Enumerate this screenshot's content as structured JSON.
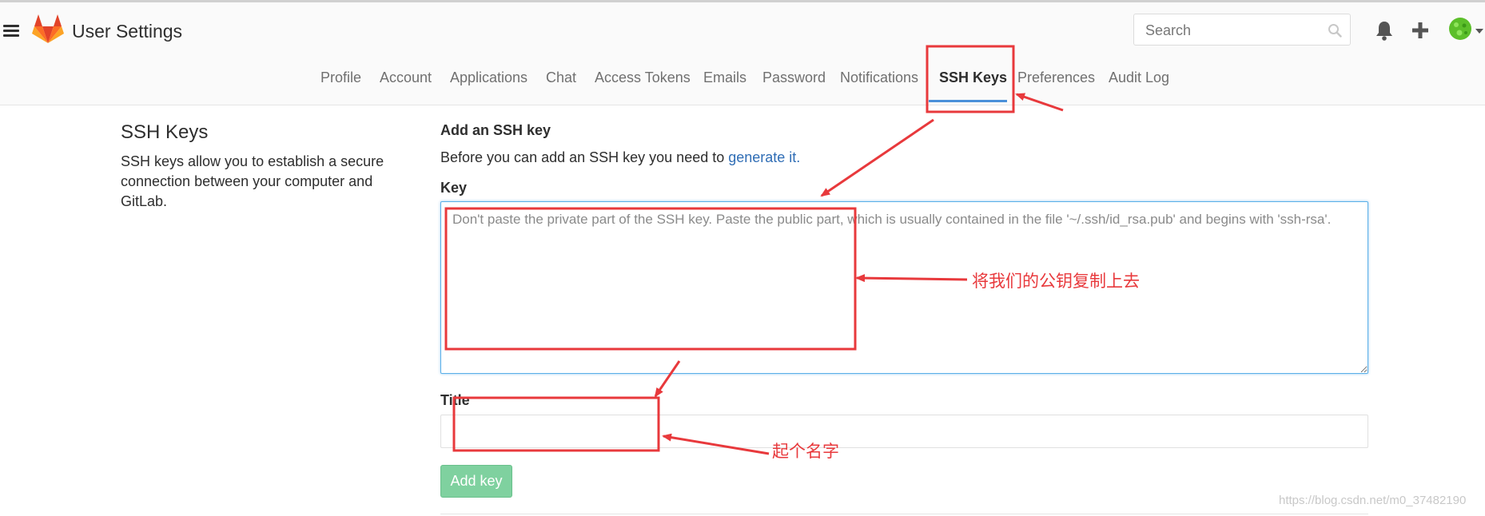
{
  "header": {
    "title": "User Settings",
    "search_placeholder": "Search"
  },
  "nav": {
    "tabs": [
      {
        "label": "Profile"
      },
      {
        "label": "Account"
      },
      {
        "label": "Applications"
      },
      {
        "label": "Chat"
      },
      {
        "label": "Access Tokens"
      },
      {
        "label": "Emails"
      },
      {
        "label": "Password"
      },
      {
        "label": "Notifications"
      },
      {
        "label": "SSH Keys",
        "active": true
      },
      {
        "label": "Preferences"
      },
      {
        "label": "Audit Log"
      }
    ]
  },
  "sidebar": {
    "title": "SSH Keys",
    "description": "SSH keys allow you to establish a secure connection between your computer and GitLab."
  },
  "form": {
    "heading": "Add an SSH key",
    "hint_prefix": "Before you can add an SSH key you need to ",
    "hint_link": "generate it.",
    "key_label": "Key",
    "key_placeholder": "Don't paste the private part of the SSH key. Paste the public part, which is usually contained in the file '~/.ssh/id_rsa.pub' and begins with 'ssh-rsa'.",
    "key_value": "",
    "title_label": "Title",
    "title_value": "",
    "submit_label": "Add key"
  },
  "annotations": {
    "key_note": "将我们的公钥复制上去",
    "title_note": "起个名字"
  },
  "watermark": "https://blog.csdn.net/m0_37482190",
  "colors": {
    "accent": "#4a90d9",
    "link": "#2f6db5",
    "submit": "#7fd19f",
    "annotation": "#e8393c"
  },
  "icons": [
    "menu-icon",
    "gitlab-logo",
    "search-icon",
    "bell-icon",
    "plus-icon",
    "avatar",
    "chevron-down-icon"
  ]
}
